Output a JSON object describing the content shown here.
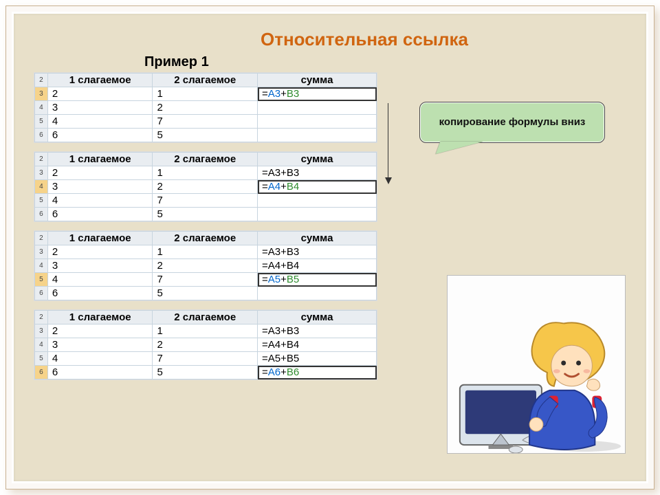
{
  "title": "Относительная ссылка",
  "subtitle": "Пример 1",
  "callout": "копирование формулы вниз",
  "headers": {
    "a": "1 слагаемое",
    "b": "2 слагаемое",
    "c": "сумма"
  },
  "tables": [
    {
      "activeRow": 3,
      "activeRowIndex": 0,
      "rows": [
        {
          "n": 3,
          "a": "2",
          "b": "1",
          "c": [
            {
              "t": "=",
              "c": ""
            },
            {
              "t": "A3",
              "c": "a"
            },
            {
              "t": "+",
              "c": ""
            },
            {
              "t": "B3",
              "c": "b"
            }
          ]
        },
        {
          "n": 4,
          "a": "3",
          "b": "2",
          "c": []
        },
        {
          "n": 5,
          "a": "4",
          "b": "7",
          "c": []
        },
        {
          "n": 6,
          "a": "6",
          "b": "5",
          "c": []
        }
      ]
    },
    {
      "activeRow": 4,
      "activeRowIndex": 1,
      "rows": [
        {
          "n": 3,
          "a": "2",
          "b": "1",
          "c": [
            {
              "t": "=A3+B3",
              "c": ""
            }
          ]
        },
        {
          "n": 4,
          "a": "3",
          "b": "2",
          "c": [
            {
              "t": "=",
              "c": ""
            },
            {
              "t": "A4",
              "c": "a"
            },
            {
              "t": "+",
              "c": ""
            },
            {
              "t": "B4",
              "c": "b"
            }
          ]
        },
        {
          "n": 5,
          "a": "4",
          "b": "7",
          "c": []
        },
        {
          "n": 6,
          "a": "6",
          "b": "5",
          "c": []
        }
      ]
    },
    {
      "activeRow": 5,
      "activeRowIndex": 2,
      "rows": [
        {
          "n": 3,
          "a": "2",
          "b": "1",
          "c": [
            {
              "t": "=A3+B3",
              "c": ""
            }
          ]
        },
        {
          "n": 4,
          "a": "3",
          "b": "2",
          "c": [
            {
              "t": "=A4+B4",
              "c": ""
            }
          ]
        },
        {
          "n": 5,
          "a": "4",
          "b": "7",
          "c": [
            {
              "t": "=",
              "c": ""
            },
            {
              "t": "A5",
              "c": "a"
            },
            {
              "t": "+",
              "c": ""
            },
            {
              "t": "B5",
              "c": "b"
            }
          ]
        },
        {
          "n": 6,
          "a": "6",
          "b": "5",
          "c": []
        }
      ]
    },
    {
      "activeRow": 6,
      "activeRowIndex": 3,
      "rows": [
        {
          "n": 3,
          "a": "2",
          "b": "1",
          "c": [
            {
              "t": "=A3+B3",
              "c": ""
            }
          ]
        },
        {
          "n": 4,
          "a": "3",
          "b": "2",
          "c": [
            {
              "t": "=A4+B4",
              "c": ""
            }
          ]
        },
        {
          "n": 5,
          "a": "4",
          "b": "7",
          "c": [
            {
              "t": "=A5+B5",
              "c": ""
            }
          ]
        },
        {
          "n": 6,
          "a": "6",
          "b": "5",
          "c": [
            {
              "t": "=",
              "c": ""
            },
            {
              "t": "A6",
              "c": "a"
            },
            {
              "t": "+",
              "c": ""
            },
            {
              "t": "B6",
              "c": "b"
            }
          ]
        }
      ]
    }
  ]
}
